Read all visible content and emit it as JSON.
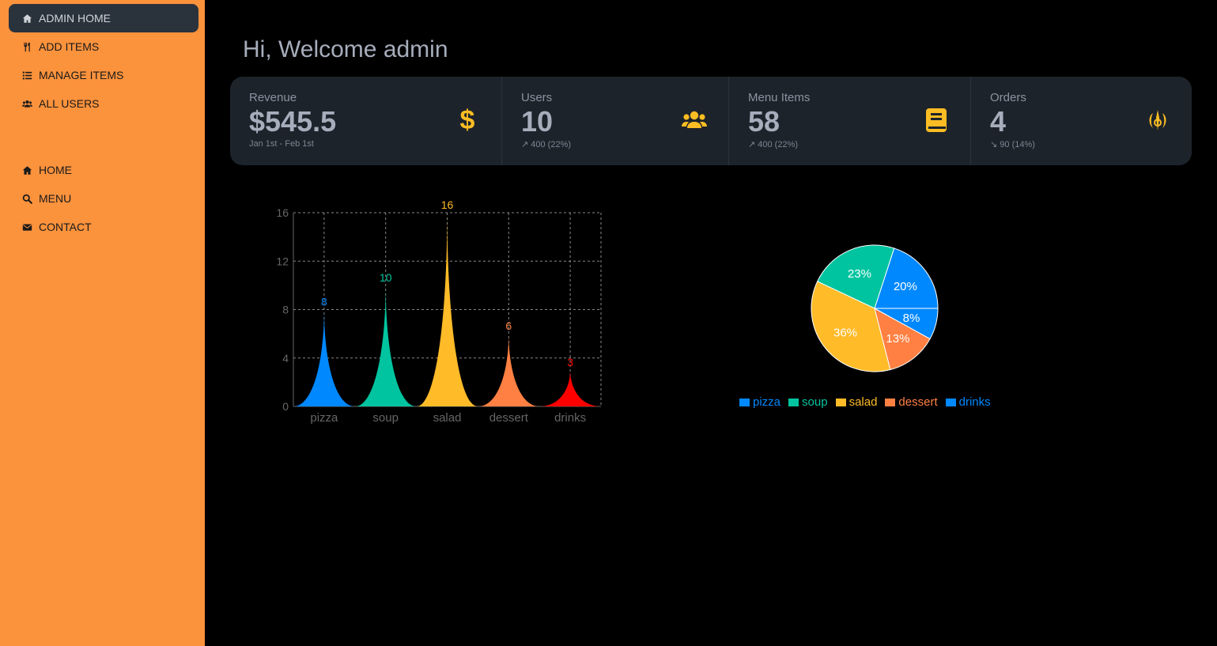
{
  "sidebar": {
    "top_items": [
      {
        "label": "ADMIN HOME",
        "icon": "home-icon"
      },
      {
        "label": "ADD ITEMS",
        "icon": "utensils-icon"
      },
      {
        "label": "MANAGE ITEMS",
        "icon": "list-icon"
      },
      {
        "label": "ALL USERS",
        "icon": "users-icon"
      }
    ],
    "bottom_items": [
      {
        "label": "HOME",
        "icon": "home-icon"
      },
      {
        "label": "MENU",
        "icon": "search-icon"
      },
      {
        "label": "CONTACT",
        "icon": "envelope-icon"
      }
    ]
  },
  "main": {
    "welcome": "Hi, Welcome admin"
  },
  "stats": [
    {
      "title": "Revenue",
      "value": "$545.5",
      "desc": "Jan 1st - Feb 1st",
      "icon": "dollar-icon"
    },
    {
      "title": "Users",
      "value": "10",
      "desc": "↗︎ 400 (22%)",
      "icon": "users-icon"
    },
    {
      "title": "Menu Items",
      "value": "58",
      "desc": "↗︎ 400 (22%)",
      "icon": "book-icon"
    },
    {
      "title": "Orders",
      "value": "4",
      "desc": "↘︎ 90 (14%)",
      "icon": "jedi-icon"
    }
  ],
  "colors": {
    "sidebar_bg": "#fb923c",
    "active_bg": "#2a323c",
    "icon_accent": "#fbbd23",
    "pizza": "#0088fe",
    "soup": "#00c49f",
    "salad": "#ffbb28",
    "dessert": "#ff8042",
    "drinks": "#ff0000"
  },
  "chart_data": [
    {
      "type": "bar",
      "categories": [
        "pizza",
        "soup",
        "salad",
        "dessert",
        "drinks"
      ],
      "values": [
        8,
        10,
        16,
        6,
        3
      ],
      "colors": [
        "#0088fe",
        "#00c49f",
        "#ffbb28",
        "#ff8042",
        "#ff0000"
      ],
      "ylim": [
        0,
        16
      ],
      "yticks": [
        0,
        4,
        8,
        12,
        16
      ],
      "grid": true
    },
    {
      "type": "pie",
      "categories": [
        "pizza",
        "soup",
        "salad",
        "dessert",
        "drinks"
      ],
      "labels": [
        "20%",
        "23%",
        "36%",
        "13%",
        "8%"
      ],
      "values": [
        20,
        23,
        36,
        13,
        8
      ],
      "colors": [
        "#0088fe",
        "#00c49f",
        "#ffbb28",
        "#ff8042",
        "#0088fe"
      ],
      "legend": "bottom"
    }
  ]
}
